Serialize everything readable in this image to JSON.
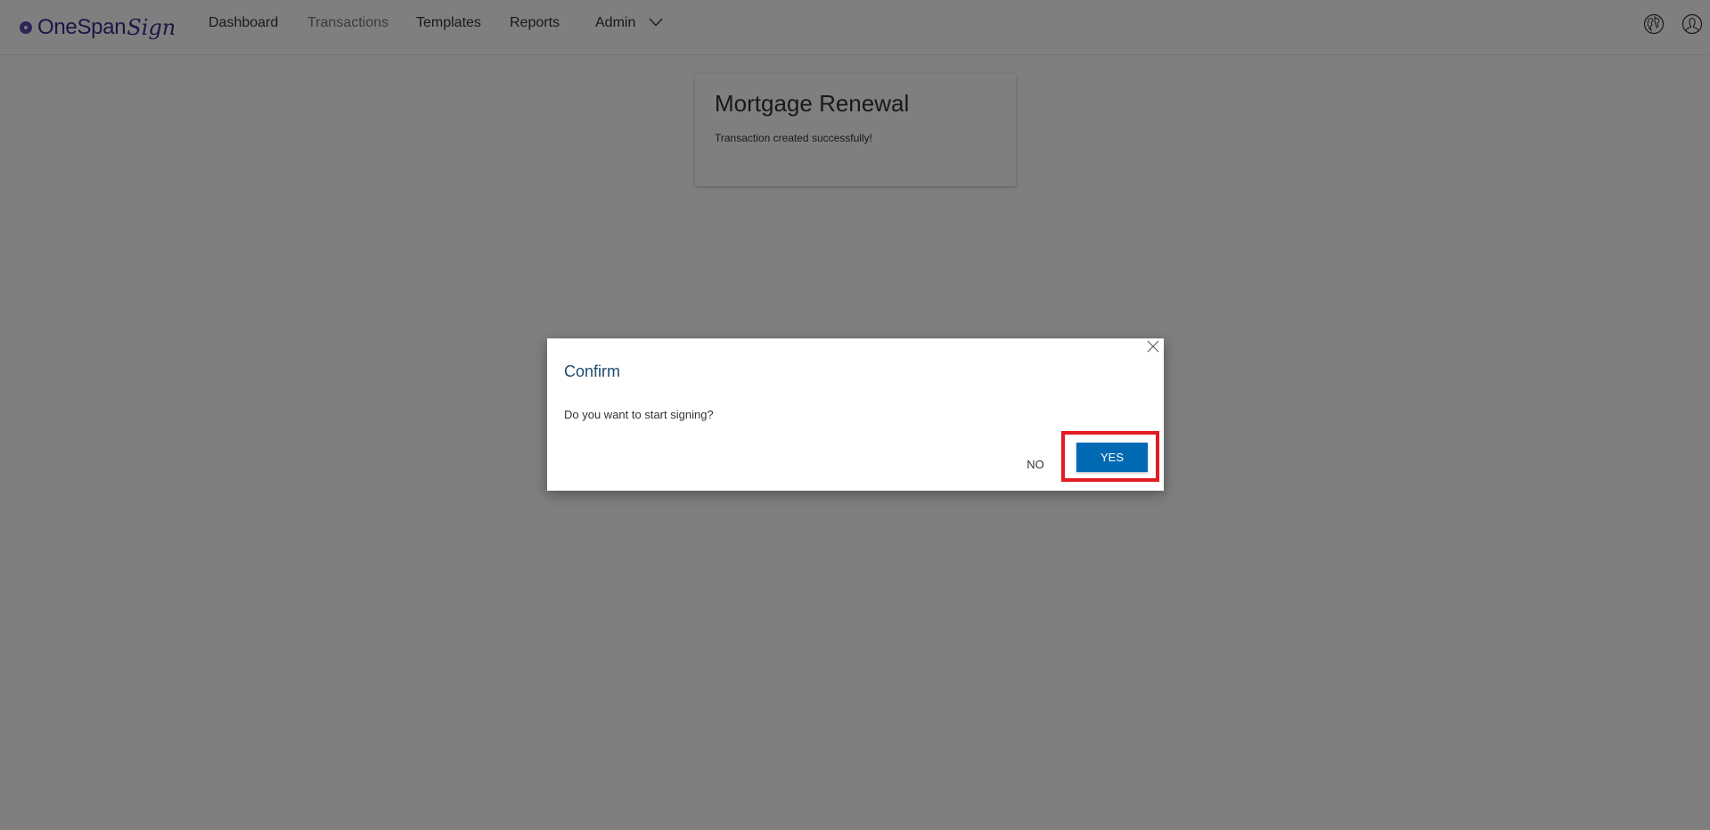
{
  "app": {
    "brand_name": "OneSpan",
    "brand_script": "Sign",
    "brand_color": "#3b2c8f"
  },
  "nav": {
    "items": [
      {
        "label": "Dashboard",
        "active": false
      },
      {
        "label": "Transactions",
        "active": true
      },
      {
        "label": "Templates",
        "active": false
      },
      {
        "label": "Reports",
        "active": false
      },
      {
        "label": "Admin",
        "has_dropdown": true
      }
    ],
    "icons": [
      "globe-icon",
      "user-icon"
    ]
  },
  "card": {
    "title": "Mortgage Renewal",
    "message": "Transaction created successfully!"
  },
  "dialog": {
    "title": "Confirm",
    "message": "Do you want to start signing?",
    "no_label": "NO",
    "yes_label": "YES",
    "yes_color": "#0069b4",
    "title_color": "#1e4a6e"
  },
  "annotation": {
    "highlight_color": "#e31b23",
    "target": "yes-button"
  }
}
